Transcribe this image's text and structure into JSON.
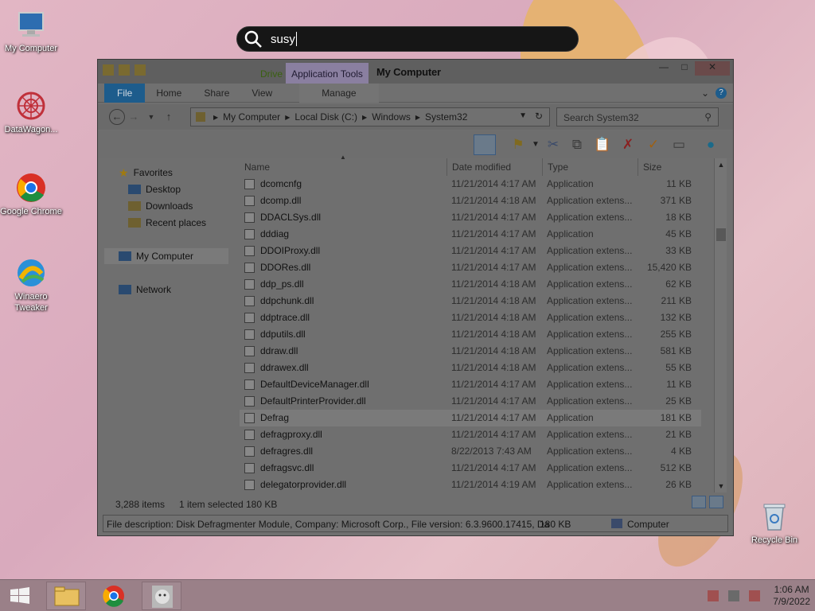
{
  "search_overlay": {
    "query": "susy"
  },
  "desktop_icons": [
    {
      "label": "My Computer"
    },
    {
      "label": "DataWagon..."
    },
    {
      "label": "Google Chrome"
    },
    {
      "label": "Winaero Tweaker"
    },
    {
      "label": "Recycle Bin"
    }
  ],
  "window": {
    "title": "My Computer",
    "contextual_tab_group": "Drive",
    "contextual_tab_group_2": "Application Tools",
    "ribbon_tabs": [
      "File",
      "Home",
      "Share",
      "View"
    ],
    "manage_tab": "Manage",
    "help": "?",
    "address_parts": [
      "My Computer",
      "Local Disk (C:)",
      "Windows",
      "System32"
    ],
    "search_placeholder": "Search System32",
    "columns": {
      "name": "Name",
      "date": "Date modified",
      "type": "Type",
      "size": "Size"
    },
    "navigation": {
      "favorites": "Favorites",
      "desktop": "Desktop",
      "downloads": "Downloads",
      "recent": "Recent places",
      "computer": "My Computer",
      "network": "Network"
    },
    "files": [
      {
        "name": "dcomcnfg",
        "date": "11/21/2014 4:17 AM",
        "type": "Application",
        "size": "11 KB"
      },
      {
        "name": "dcomp.dll",
        "date": "11/21/2014 4:18 AM",
        "type": "Application extens...",
        "size": "371 KB"
      },
      {
        "name": "DDACLSys.dll",
        "date": "11/21/2014 4:17 AM",
        "type": "Application extens...",
        "size": "18 KB"
      },
      {
        "name": "dddiag",
        "date": "11/21/2014 4:17 AM",
        "type": "Application",
        "size": "45 KB"
      },
      {
        "name": "DDOIProxy.dll",
        "date": "11/21/2014 4:17 AM",
        "type": "Application extens...",
        "size": "33 KB"
      },
      {
        "name": "DDORes.dll",
        "date": "11/21/2014 4:17 AM",
        "type": "Application extens...",
        "size": "15,420 KB"
      },
      {
        "name": "ddp_ps.dll",
        "date": "11/21/2014 4:18 AM",
        "type": "Application extens...",
        "size": "62 KB"
      },
      {
        "name": "ddpchunk.dll",
        "date": "11/21/2014 4:18 AM",
        "type": "Application extens...",
        "size": "211 KB"
      },
      {
        "name": "ddptrace.dll",
        "date": "11/21/2014 4:18 AM",
        "type": "Application extens...",
        "size": "132 KB"
      },
      {
        "name": "ddputils.dll",
        "date": "11/21/2014 4:18 AM",
        "type": "Application extens...",
        "size": "255 KB"
      },
      {
        "name": "ddraw.dll",
        "date": "11/21/2014 4:18 AM",
        "type": "Application extens...",
        "size": "581 KB"
      },
      {
        "name": "ddrawex.dll",
        "date": "11/21/2014 4:18 AM",
        "type": "Application extens...",
        "size": "55 KB"
      },
      {
        "name": "DefaultDeviceManager.dll",
        "date": "11/21/2014 4:17 AM",
        "type": "Application extens...",
        "size": "11 KB"
      },
      {
        "name": "DefaultPrinterProvider.dll",
        "date": "11/21/2014 4:17 AM",
        "type": "Application extens...",
        "size": "25 KB"
      },
      {
        "name": "Defrag",
        "date": "11/21/2014 4:17 AM",
        "type": "Application",
        "size": "181 KB"
      },
      {
        "name": "defragproxy.dll",
        "date": "11/21/2014 4:17 AM",
        "type": "Application extens...",
        "size": "21 KB"
      },
      {
        "name": "defragres.dll",
        "date": "8/22/2013 7:43 AM",
        "type": "Application extens...",
        "size": "4 KB"
      },
      {
        "name": "defragsvc.dll",
        "date": "11/21/2014 4:17 AM",
        "type": "Application extens...",
        "size": "512 KB"
      },
      {
        "name": "delegatorprovider.dll",
        "date": "11/21/2014 4:19 AM",
        "type": "Application extens...",
        "size": "26 KB"
      }
    ],
    "status": {
      "count": "3,288 items",
      "selected": "1 item selected",
      "size": "180 KB"
    },
    "details_bar": {
      "description": "File description: Disk Defragmenter Module, Company: Microsoft Corp., File version: 6.3.9600.17415, Da",
      "size": "180 KB",
      "location": "Computer"
    }
  },
  "taskbar": {
    "clock_time": "1:06 AM",
    "clock_date": "7/9/2022"
  }
}
